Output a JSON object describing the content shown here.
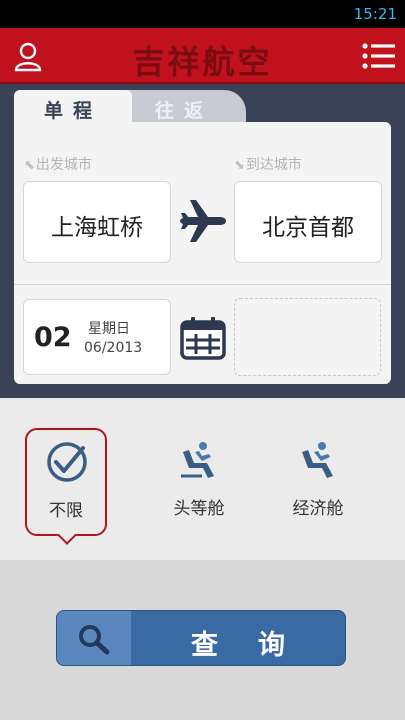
{
  "status_bar": {
    "time": "15:21"
  },
  "header": {
    "title": "吉祥航空",
    "user_icon": "user-icon",
    "menu_icon": "menu-icon"
  },
  "tabs": [
    {
      "label": "单程",
      "selected": true
    },
    {
      "label": "往返",
      "selected": false
    }
  ],
  "route": {
    "departure_label": "出发城市",
    "departure_city": "上海虹桥",
    "arrival_label": "到达城市",
    "arrival_city": "北京首都",
    "swap_icon": "airplane-icon"
  },
  "date": {
    "day": "02",
    "weekday": "星期日",
    "month_year": "06/2013",
    "calendar_icon": "calendar-icon",
    "return_date": ""
  },
  "cabin_classes": [
    {
      "label": "不限",
      "icon": "check-circle-icon",
      "selected": true
    },
    {
      "label": "头等舱",
      "icon": "seat-icon",
      "selected": false
    },
    {
      "label": "经济舱",
      "icon": "seat-icon",
      "selected": false
    }
  ],
  "search_button": {
    "label": "查询",
    "icon": "search-icon"
  },
  "colors": {
    "brand_red": "#c0111c",
    "panel_navy": "#3a4257",
    "button_blue": "#3a6aa3"
  }
}
